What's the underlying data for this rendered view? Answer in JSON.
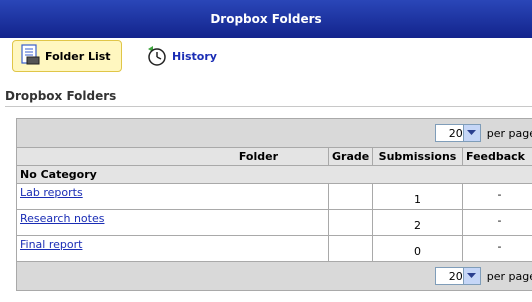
{
  "window": {
    "title": "Dropbox Folders"
  },
  "toolbar": {
    "folder_list_label": "Folder List",
    "history_label": "History",
    "folder_list_icon": "folder-list-icon",
    "history_icon": "history-clock-icon"
  },
  "section": {
    "title": "Dropbox Folders"
  },
  "pager": {
    "per_page_value": "20",
    "per_page_label": "per page"
  },
  "table": {
    "headers": {
      "folder": "Folder",
      "grade": "Grade",
      "submissions": "Submissions",
      "feedback": "Feedback"
    },
    "category": "No Category",
    "rows": [
      {
        "name": "Lab reports",
        "grade": "",
        "submissions": "1",
        "feedback": "-"
      },
      {
        "name": "Research notes",
        "grade": "",
        "submissions": "2",
        "feedback": "-"
      },
      {
        "name": "Final report",
        "grade": "",
        "submissions": "0",
        "feedback": "-"
      }
    ]
  },
  "colors": {
    "title_bar": "#1a2d9c",
    "link": "#1a2db5",
    "active_tool_bg": "#fff7c0"
  }
}
